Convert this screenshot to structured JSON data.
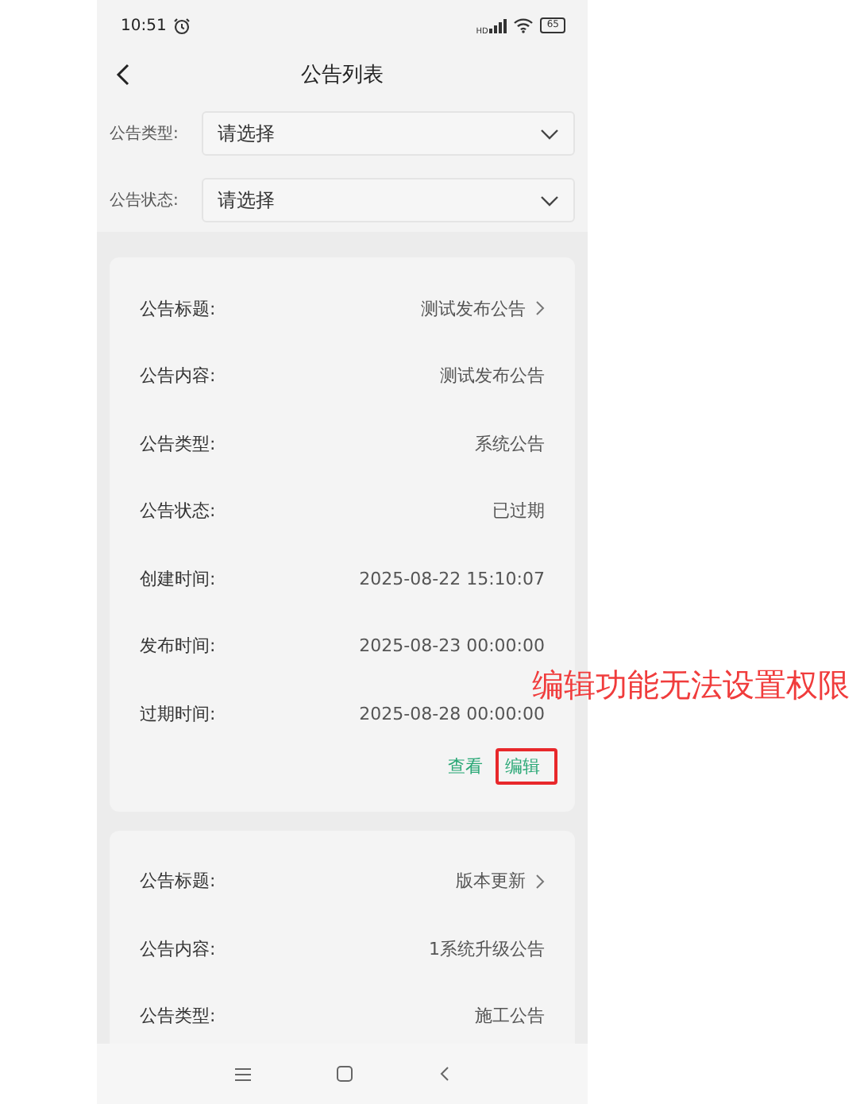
{
  "status_bar": {
    "time": "10:51",
    "network": "HD",
    "battery": "65"
  },
  "header": {
    "title": "公告列表"
  },
  "filters": [
    {
      "label": "公告类型:",
      "placeholder": "请选择"
    },
    {
      "label": "公告状态:",
      "placeholder": "请选择"
    }
  ],
  "cards": [
    {
      "rows": [
        {
          "label": "公告标题:",
          "value": "测试发布公告",
          "link": true
        },
        {
          "label": "公告内容:",
          "value": "测试发布公告",
          "link": false
        },
        {
          "label": "公告类型:",
          "value": "系统公告",
          "link": false
        },
        {
          "label": "公告状态:",
          "value": "已过期",
          "link": false
        },
        {
          "label": "创建时间:",
          "value": "2025-08-22 15:10:07",
          "link": false
        },
        {
          "label": "发布时间:",
          "value": "2025-08-23 00:00:00",
          "link": false
        },
        {
          "label": "过期时间:",
          "value": "2025-08-28 00:00:00",
          "link": false
        }
      ],
      "actions": [
        {
          "label": "查看",
          "highlighted": false
        },
        {
          "label": "编辑",
          "highlighted": true
        }
      ]
    },
    {
      "rows": [
        {
          "label": "公告标题:",
          "value": "版本更新",
          "link": true
        },
        {
          "label": "公告内容:",
          "value": "1系统升级公告",
          "link": false
        },
        {
          "label": "公告类型:",
          "value": "施工公告",
          "link": false
        }
      ]
    }
  ],
  "annotation": {
    "text": "编辑功能无法设置权限"
  }
}
